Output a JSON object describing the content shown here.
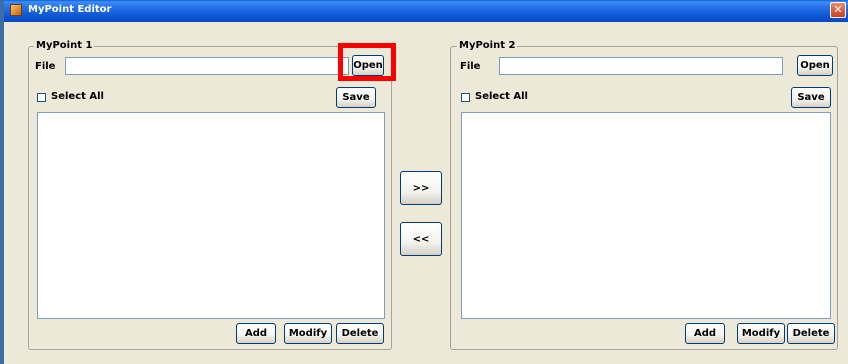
{
  "window": {
    "title": "MyPoint Editor"
  },
  "panel_left": {
    "legend": "MyPoint 1",
    "file_label": "File",
    "file_value": "",
    "open_label": "Open",
    "select_all_label": "Select All",
    "save_label": "Save",
    "add_label": "Add",
    "modify_label": "Modify",
    "delete_label": "Delete"
  },
  "panel_right": {
    "legend": "MyPoint 2",
    "file_label": "File",
    "file_value": "",
    "open_label": "Open",
    "select_all_label": "Select All",
    "save_label": "Save",
    "add_label": "Add",
    "modify_label": "Modify",
    "delete_label": "Delete"
  },
  "transfer": {
    "to_right_label": ">>",
    "to_left_label": "<<"
  },
  "colors": {
    "highlight": "#ff0000",
    "titlebar": "#0a5fd8"
  }
}
